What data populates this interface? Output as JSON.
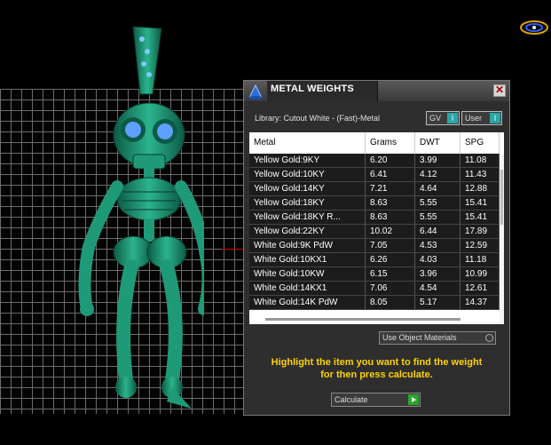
{
  "dialog": {
    "title": "METAL WEIGHTS",
    "close_glyph": "✕",
    "library_label": "Library: Cutout White - (Fast)-Metal",
    "toggles": {
      "gv": {
        "label": "GV",
        "knob": "I"
      },
      "user": {
        "label": "User",
        "knob": "I"
      }
    },
    "table": {
      "headers": [
        "Metal",
        "Grams",
        "DWT",
        "SPG"
      ],
      "rows": [
        [
          "Yellow Gold:9KY",
          "6.20",
          "3.99",
          "11.08"
        ],
        [
          "Yellow Gold:10KY",
          "6.41",
          "4.12",
          "11.43"
        ],
        [
          "Yellow Gold:14KY",
          "7.21",
          "4.64",
          "12.88"
        ],
        [
          "Yellow Gold:18KY",
          "8.63",
          "5.55",
          "15.41"
        ],
        [
          "Yellow Gold:18KY R...",
          "8.63",
          "5.55",
          "15.41"
        ],
        [
          "Yellow Gold:22KY",
          "10.02",
          "6.44",
          "17.89"
        ],
        [
          "White Gold:9K PdW",
          "7.05",
          "4.53",
          "12.59"
        ],
        [
          "White Gold:10KX1",
          "6.26",
          "4.03",
          "11.18"
        ],
        [
          "White Gold:10KW",
          "6.15",
          "3.96",
          "10.99"
        ],
        [
          "White Gold:14KX1",
          "7.06",
          "4.54",
          "12.61"
        ],
        [
          "White Gold:14K PdW",
          "8.05",
          "5.17",
          "14.37"
        ]
      ]
    },
    "use_object_materials": "Use Object Materials",
    "instruction_line1": "Highlight the item you want to find the weight",
    "instruction_line2": "for then press calculate.",
    "calculate_label": "Calculate"
  },
  "colors": {
    "model": "#1f9a78",
    "model_dark": "#0c5a45",
    "eye": "#5ea0ff",
    "instruction": "#ffd200",
    "toggle_knob": "#2aa7a7",
    "calc_arrow": "#2aa52a"
  },
  "icons": {
    "dialog_icon": "metal-weights-app-icon",
    "gizmo": "view-gizmo-icon"
  }
}
